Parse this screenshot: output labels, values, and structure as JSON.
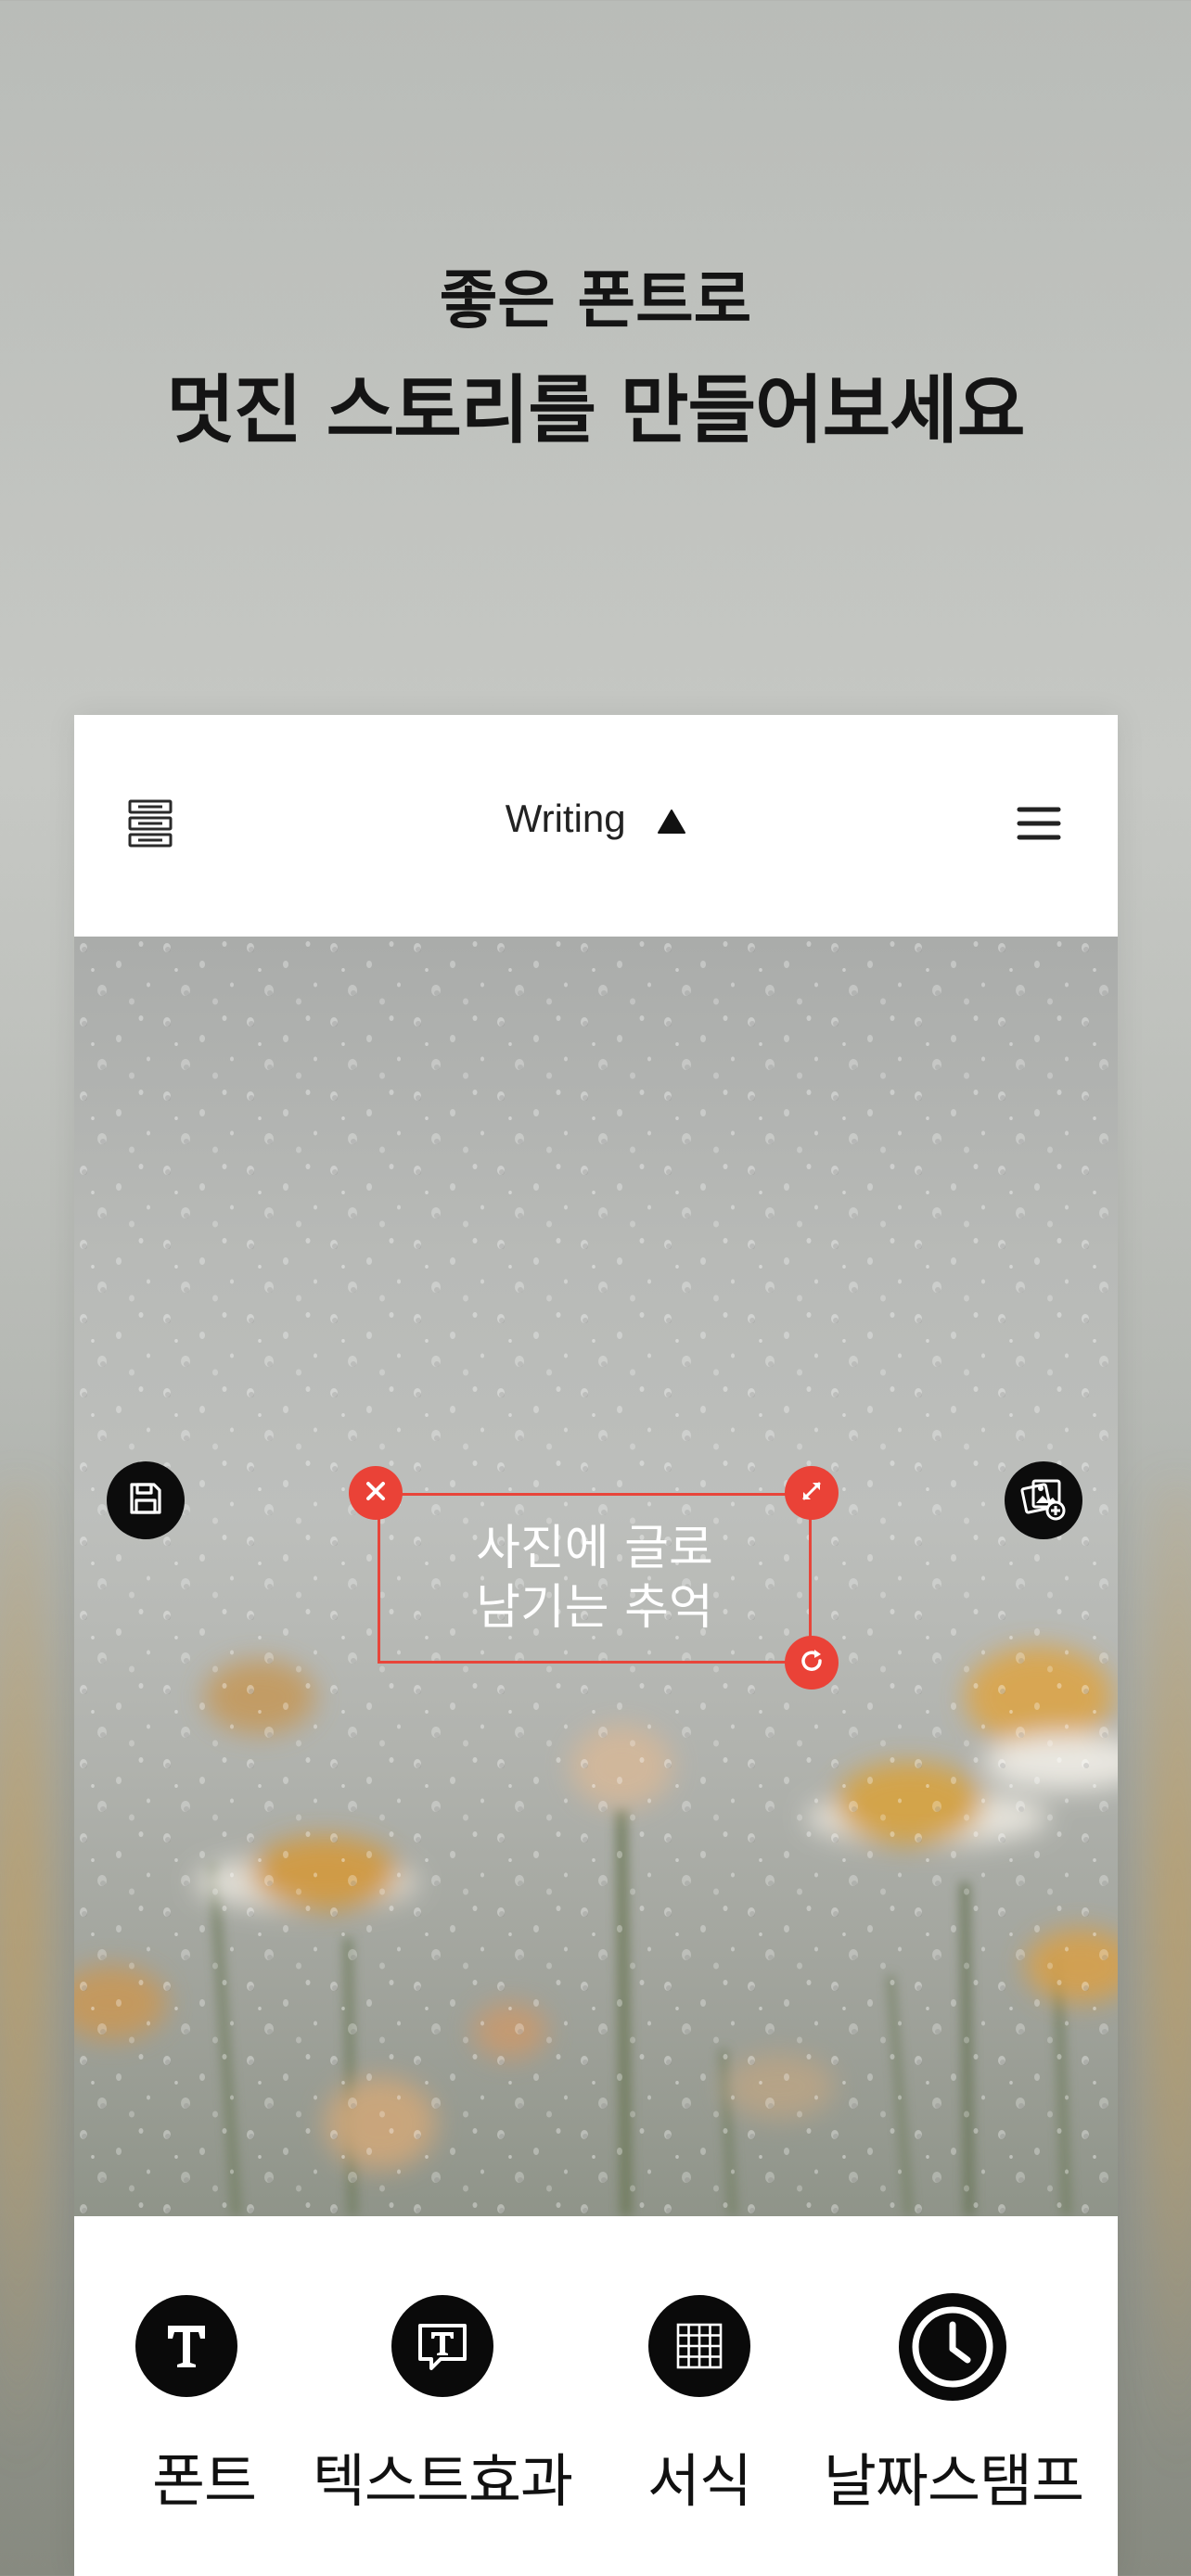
{
  "promo": {
    "line1": "좋은 폰트로",
    "line2": "멋진 스토리를 만들어보세요"
  },
  "app": {
    "title": "Writing",
    "left_icon": "layers-icon",
    "menu_icon": "hamburger-menu-icon"
  },
  "canvas": {
    "save_icon": "save-icon",
    "add_photo_icon": "add-photo-icon",
    "text_line1": "사진에 글로",
    "text_line2": "남기는 추억",
    "handle_delete_icon": "close-icon",
    "handle_resize_icon": "resize-icon",
    "handle_rotate_icon": "rotate-icon",
    "accent_color": "#e8453a"
  },
  "toolbar": {
    "font_label": "폰트",
    "text_effect_label": "텍스트효과",
    "format_label": "서식",
    "date_stamp_label": "날짜스탬프"
  }
}
